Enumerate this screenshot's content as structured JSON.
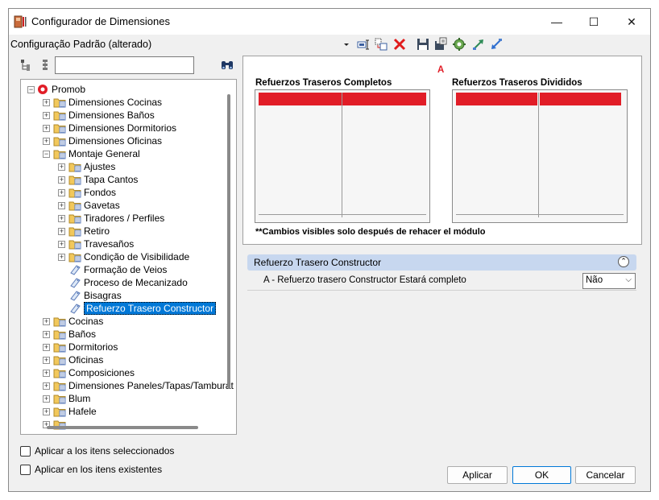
{
  "window": {
    "title": "Configurador de Dimensiones",
    "minimize_glyph": "—",
    "maximize_glyph": "☐",
    "close_glyph": "✕"
  },
  "toolbar": {
    "config_name": "Configuração Padrão (alterado)",
    "icons": [
      "dropdown-arrow-icon",
      "rename-icon",
      "copy-icon",
      "delete-icon",
      "save-icon",
      "save-as-icon",
      "settings-icon",
      "export-icon",
      "import-icon"
    ]
  },
  "tree": {
    "search_value": "",
    "items": [
      {
        "label": "Promob",
        "level": 0,
        "expander": "−",
        "icon": "promob-logo"
      },
      {
        "label": "Dimensiones Cocinas",
        "level": 1,
        "expander": "+",
        "icon": "folder"
      },
      {
        "label": "Dimensiones Baños",
        "level": 1,
        "expander": "+",
        "icon": "folder"
      },
      {
        "label": "Dimensiones Dormitorios",
        "level": 1,
        "expander": "+",
        "icon": "folder"
      },
      {
        "label": "Dimensiones Oficinas",
        "level": 1,
        "expander": "+",
        "icon": "folder"
      },
      {
        "label": "Montaje General",
        "level": 1,
        "expander": "−",
        "icon": "folder"
      },
      {
        "label": "Ajustes",
        "level": 2,
        "expander": "+",
        "icon": "folder"
      },
      {
        "label": "Tapa Cantos",
        "level": 2,
        "expander": "+",
        "icon": "folder"
      },
      {
        "label": "Fondos",
        "level": 2,
        "expander": "+",
        "icon": "folder"
      },
      {
        "label": "Gavetas",
        "level": 2,
        "expander": "+",
        "icon": "folder"
      },
      {
        "label": "Tiradores / Perfiles",
        "level": 2,
        "expander": "+",
        "icon": "folder"
      },
      {
        "label": "Retiro",
        "level": 2,
        "expander": "+",
        "icon": "folder"
      },
      {
        "label": "Travesaños",
        "level": 2,
        "expander": "+",
        "icon": "folder"
      },
      {
        "label": "Condição de Visibilidade",
        "level": 2,
        "expander": "+",
        "icon": "folder"
      },
      {
        "label": "Formação de Veios",
        "level": 2,
        "expander": "",
        "icon": "tag"
      },
      {
        "label": "Proceso de Mecanizado",
        "level": 2,
        "expander": "",
        "icon": "tag"
      },
      {
        "label": "Bisagras",
        "level": 2,
        "expander": "",
        "icon": "tag"
      },
      {
        "label": "Refuerzo Trasero Constructor",
        "level": 2,
        "expander": "",
        "icon": "tag",
        "selected": true
      },
      {
        "label": "Cocinas",
        "level": 1,
        "expander": "+",
        "icon": "folder"
      },
      {
        "label": "Baños",
        "level": 1,
        "expander": "+",
        "icon": "folder"
      },
      {
        "label": "Dormitorios",
        "level": 1,
        "expander": "+",
        "icon": "folder"
      },
      {
        "label": "Oficinas",
        "level": 1,
        "expander": "+",
        "icon": "folder"
      },
      {
        "label": "Composiciones",
        "level": 1,
        "expander": "+",
        "icon": "folder"
      },
      {
        "label": "Dimensiones Paneles/Tapas/Tamburat",
        "level": 1,
        "expander": "+",
        "icon": "folder"
      },
      {
        "label": "Blum",
        "level": 1,
        "expander": "+",
        "icon": "folder"
      },
      {
        "label": "Hafele",
        "level": 1,
        "expander": "+",
        "icon": "folder"
      },
      {
        "label": "",
        "level": 1,
        "expander": "+",
        "icon": "folder"
      }
    ]
  },
  "preview": {
    "marker": "A",
    "left_title": "Refuerzos Traseros Completos",
    "right_title": "Refuerzos Traseros Divididos",
    "note": "**Cambios visibles solo después de rehacer el módulo"
  },
  "properties": {
    "section_title": "Refuerzo Trasero Constructor",
    "collapse_glyph": "⌃",
    "rows": [
      {
        "label": "A - Refuerzo trasero Constructor Estará completo",
        "value": "Não"
      }
    ]
  },
  "options": {
    "apply_selected": "Aplicar a los itens seleccionados",
    "apply_existing": "Aplicar en los itens existentes"
  },
  "buttons": {
    "apply": "Aplicar",
    "ok": "OK",
    "cancel": "Cancelar"
  },
  "colors": {
    "accent_red": "#e11d27",
    "selection_blue": "#0078d7",
    "section_header": "#c7d7ef"
  }
}
